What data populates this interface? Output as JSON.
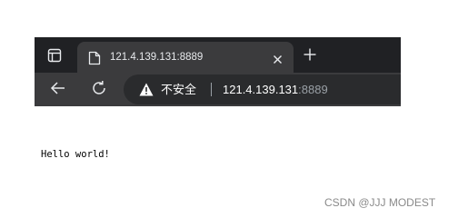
{
  "tab": {
    "title": "121.4.139.131:8889"
  },
  "toolbar": {
    "security_label": "不安全",
    "url_host": "121.4.139.131",
    "url_port": ":8889"
  },
  "page": {
    "body_text": "Hello world!"
  },
  "watermark": "CSDN @JJJ MODEST",
  "colors": {
    "tabbar_bg": "#202124",
    "toolbar_bg": "#3b3b3d",
    "omnibox_bg": "#2a2b2d",
    "text_light": "#e8eaed",
    "url_muted": "#9aa0a6"
  },
  "icons": [
    "tab-actions-icon",
    "page-favicon-icon",
    "close-icon",
    "plus-icon",
    "back-arrow-icon",
    "reload-icon",
    "warning-icon"
  ]
}
